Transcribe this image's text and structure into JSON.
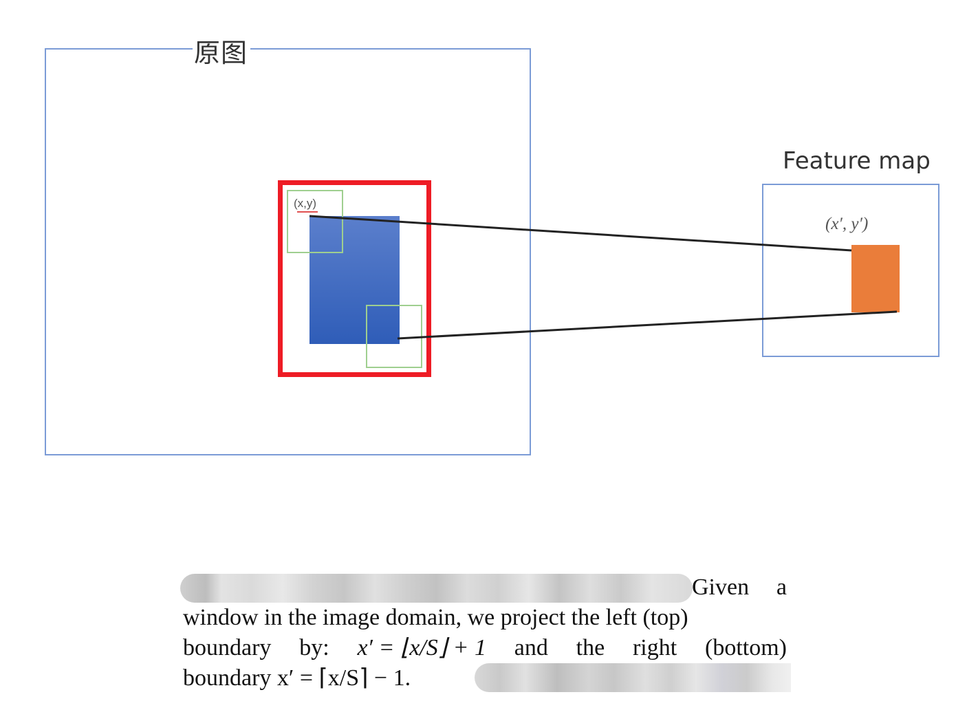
{
  "labels": {
    "original_image": "原图",
    "feature_map": "Feature map",
    "point_xy": "(x,y)",
    "point_xpyp": "(x′, y′)"
  },
  "colors": {
    "frame_blue": "#7b9bd6",
    "roi_red": "#ee1c25",
    "blue_box_top": "#5b7fcc",
    "blue_box_bottom": "#2f5db8",
    "window_green": "#9fcf8f",
    "feature_orange": "#ea7d3a",
    "projection_line": "#222222"
  },
  "caption": {
    "line1_end_word1": "Given",
    "line1_end_word2": "a",
    "line2": "window in the image domain, we project the left (top)",
    "line3": [
      "boundary",
      "by:",
      "x′ = ⌊x/S⌋ + 1",
      "and",
      "the",
      "right",
      "(bottom)"
    ],
    "line4": "boundary x′ = ⌈x/S⌉ − 1."
  }
}
